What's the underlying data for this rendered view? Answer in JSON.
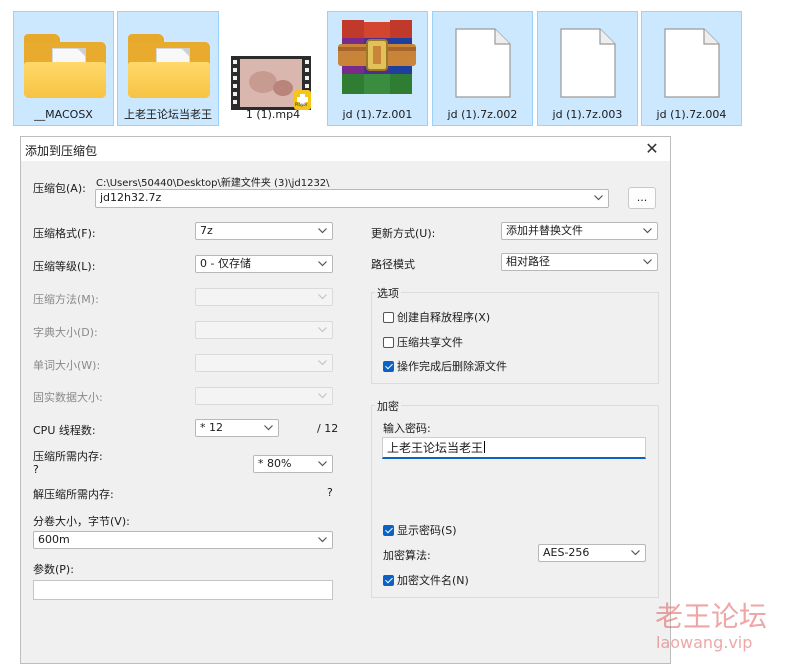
{
  "explorer": {
    "files": [
      {
        "name": "__MACOSX",
        "type": "folder",
        "selected": true
      },
      {
        "name": "上老王论坛当老王",
        "type": "folder",
        "selected": true
      },
      {
        "name": "1 (1).mp4",
        "type": "video",
        "selected": false,
        "badge": "Player"
      },
      {
        "name": "jd (1).7z.001",
        "type": "winrar-archive",
        "selected": true
      },
      {
        "name": "jd (1).7z.002",
        "type": "document",
        "selected": true
      },
      {
        "name": "jd (1).7z.003",
        "type": "document",
        "selected": true
      },
      {
        "name": "jd (1).7z.004",
        "type": "document",
        "selected": true
      }
    ]
  },
  "dialog": {
    "title": "添加到压缩包",
    "close_icon": "close-icon",
    "archive": {
      "label": "压缩包(A):",
      "path": "C:\\Users\\50440\\Desktop\\新建文件夹 (3)\\jd1232\\",
      "value": "jd12h32.7z",
      "browse_label": "..."
    },
    "left": {
      "format_label": "压缩格式(F):",
      "format_value": "7z",
      "level_label": "压缩等级(L):",
      "level_value": "0 - 仅存储",
      "method_label": "压缩方法(M):",
      "dict_label": "字典大小(D):",
      "word_label": "单词大小(W):",
      "solid_label": "固实数据大小:",
      "cpu_label": "CPU 线程数:",
      "cpu_value": "* 12",
      "cpu_total": "/ 12",
      "mem_label": "压缩所需内存:",
      "mem_question": "?",
      "mem_value": "* 80%",
      "decomp_label": "解压缩所需内存:",
      "decomp_value": "?",
      "volume_label": "分卷大小，字节(V):",
      "volume_value": "600m",
      "params_label": "参数(P):",
      "params_value": ""
    },
    "right": {
      "update_label": "更新方式(U):",
      "update_value": "添加并替换文件",
      "path_label": "路径模式",
      "path_value": "相对路径",
      "options": {
        "title": "选项",
        "sfx_label": "创建自释放程序(X)",
        "sfx_checked": false,
        "shared_label": "压缩共享文件",
        "shared_checked": false,
        "delete_label": "操作完成后删除源文件",
        "delete_checked": true
      },
      "encryption": {
        "title": "加密",
        "password_label": "输入密码:",
        "password_value": "上老王论坛当老王",
        "show_label": "显示密码(S)",
        "show_checked": true,
        "method_label": "加密算法:",
        "method_value": "AES-256",
        "names_label": "加密文件名(N)",
        "names_checked": true
      }
    }
  },
  "watermark": {
    "text": "老王论坛",
    "url": "laowang.vip",
    "color": "#e05c5c"
  },
  "colors": {
    "selection": "#cce8ff",
    "selection_border": "#99d1ff",
    "accent": "#0b62c4",
    "dialog_bg": "#f0f0f0"
  }
}
